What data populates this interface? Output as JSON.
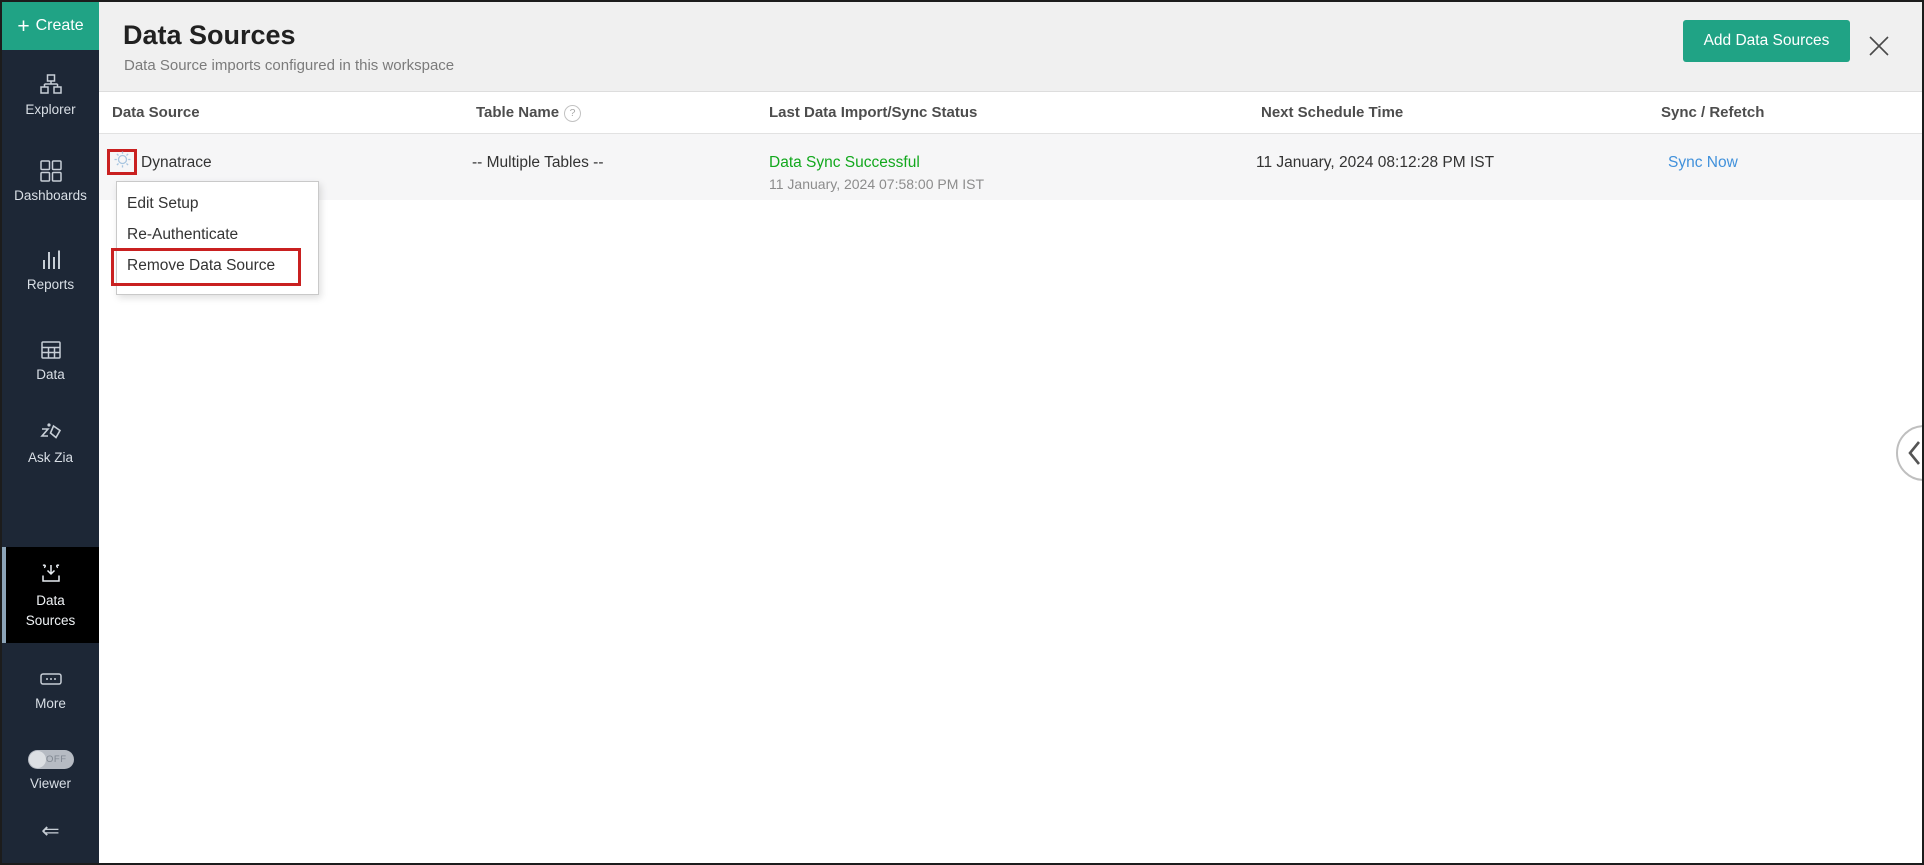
{
  "sidebar": {
    "create": {
      "label": "Create",
      "plus_glyph": "+"
    },
    "items": [
      {
        "id": "explorer",
        "label": "Explorer",
        "icon": "explorer-icon",
        "active": false
      },
      {
        "id": "dashboards",
        "label": "Dashboards",
        "icon": "dashboards-icon",
        "active": false
      },
      {
        "id": "reports",
        "label": "Reports",
        "icon": "reports-icon",
        "active": false
      },
      {
        "id": "data",
        "label": "Data",
        "icon": "data-icon",
        "active": false
      },
      {
        "id": "ask-zia",
        "label": "Ask Zia",
        "icon": "ask-zia-icon",
        "active": false
      },
      {
        "id": "data-sources",
        "label_line1": "Data",
        "label_line2": "Sources",
        "icon": "data-sources-icon",
        "active": true
      },
      {
        "id": "more",
        "label": "More",
        "icon": "more-icon",
        "active": false
      }
    ],
    "viewer_toggle": {
      "label": "Viewer",
      "state": "OFF"
    },
    "collapse_glyph": "⇐"
  },
  "header": {
    "title": "Data Sources",
    "subtitle": "Data Source imports configured in this workspace",
    "add_button_label": "Add Data Sources"
  },
  "table": {
    "columns": [
      "Data Source",
      "Table Name",
      "Last Data Import/Sync Status",
      "Next Schedule Time",
      "Sync / Refetch"
    ],
    "help_glyph": "?",
    "rows": [
      {
        "name": "Dynatrace",
        "table_name": "-- Multiple Tables --",
        "status": "Data Sync Successful",
        "status_time": "11 January, 2024 07:58:00 PM IST",
        "next_schedule": "11 January, 2024 08:12:28 PM IST",
        "action": "Sync Now"
      }
    ]
  },
  "context_menu": {
    "items": [
      "Edit Setup",
      "Re-Authenticate",
      "Remove Data Source"
    ]
  },
  "colors": {
    "accent_green": "#20A385",
    "status_green": "#12A81D",
    "link_blue": "#4191DB",
    "annotation_red": "#C92020",
    "sidebar_bg": "#1D2736",
    "active_item_bg": "#000000",
    "active_item_accent": "#8CA4B8",
    "header_band_bg": "#F0F0F0",
    "row_bg": "#F6F6F7"
  }
}
